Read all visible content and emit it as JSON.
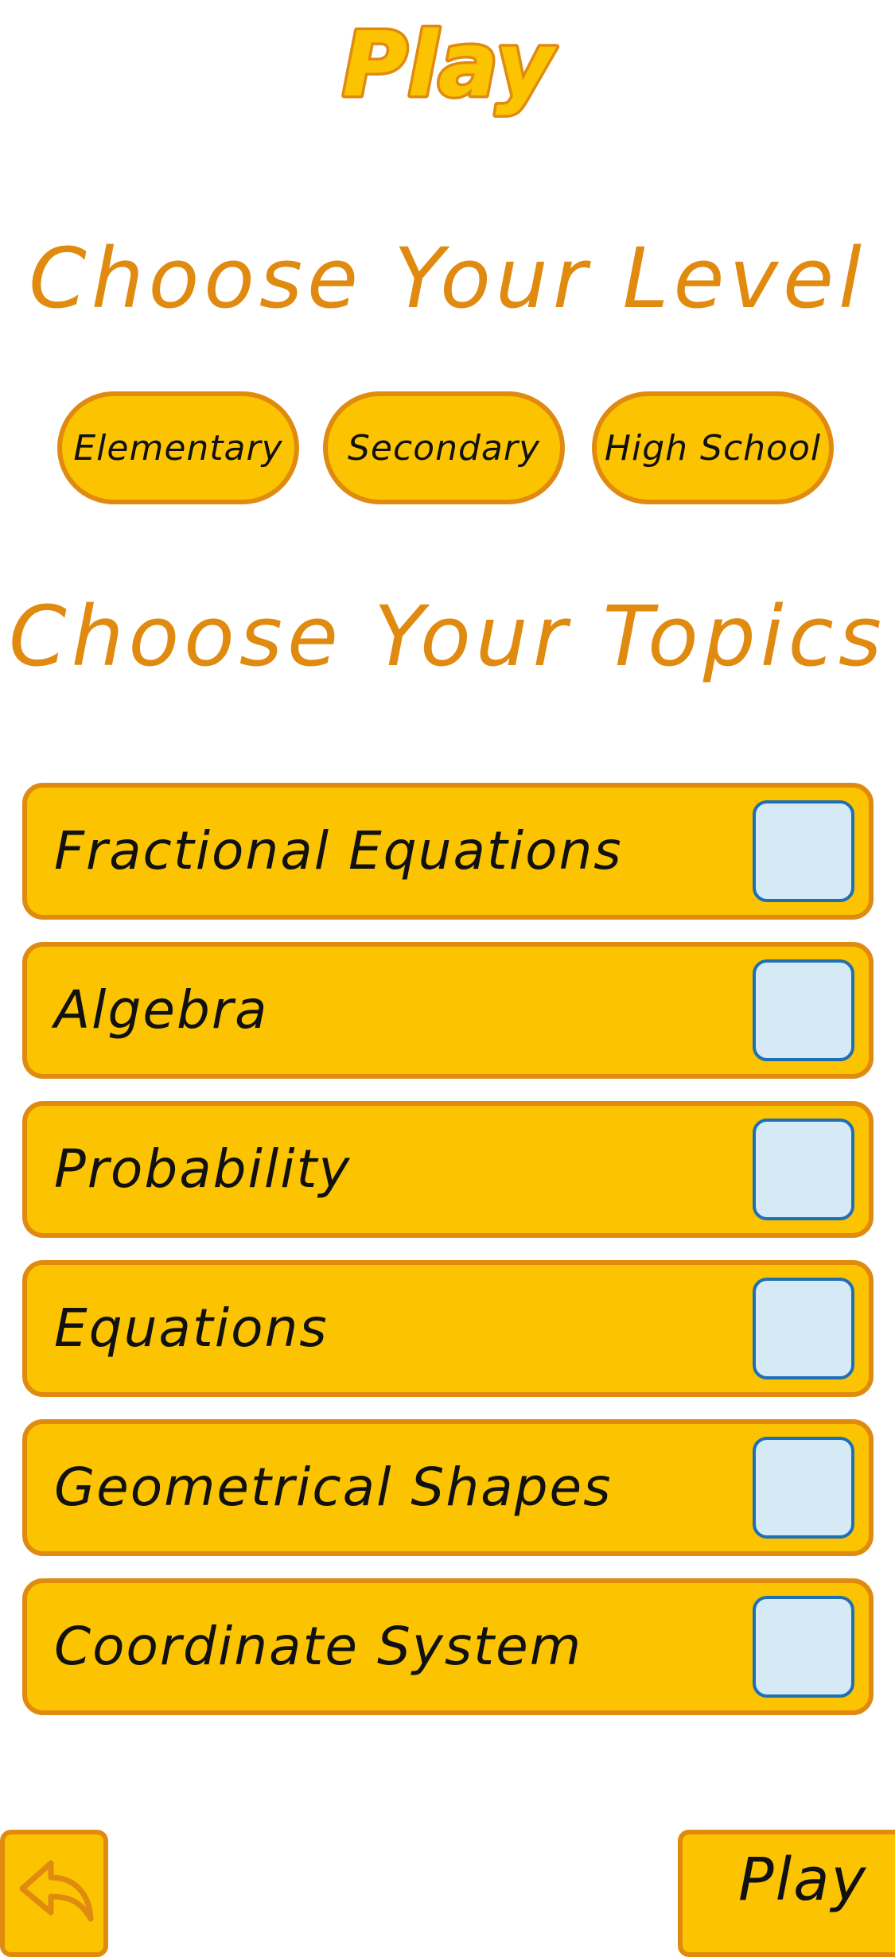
{
  "header": {
    "title": "Play"
  },
  "level": {
    "heading": "Choose Your Level",
    "options": [
      "Elementary",
      "Secondary",
      "High School"
    ]
  },
  "topics": {
    "heading": "Choose Your Topics",
    "items": [
      {
        "label": "Fractional Equations",
        "checked": false
      },
      {
        "label": "Algebra",
        "checked": false
      },
      {
        "label": "Probability",
        "checked": false
      },
      {
        "label": "Equations",
        "checked": false
      },
      {
        "label": "Geometrical Shapes",
        "checked": false
      },
      {
        "label": "Coordinate System",
        "checked": false
      }
    ]
  },
  "footer": {
    "back_icon": "back-arrow-icon",
    "play_label": "Play"
  },
  "colors": {
    "accent": "#e08a10",
    "fill": "#fcc400",
    "checkbox_fill": "#d6eaf6",
    "checkbox_border": "#1f6fb4"
  }
}
